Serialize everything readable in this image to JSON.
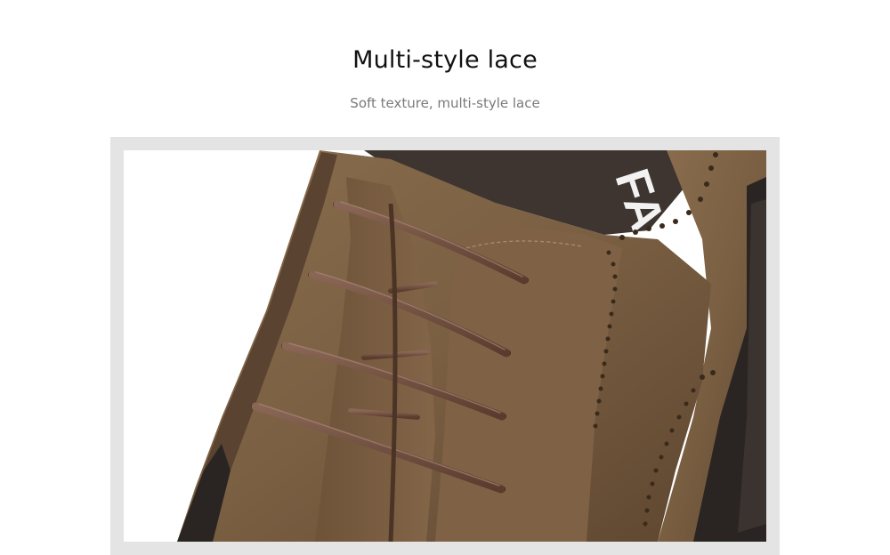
{
  "heading": {
    "title": "Multi-style lace",
    "subtitle": "Soft texture, multi-style lace"
  },
  "image": {
    "subject": "brown-leather-brogue-shoe-laces",
    "colors": {
      "frame": "#e4e4e4",
      "leather": "#7a5f42",
      "leather_dark": "#4f3a27",
      "lace": "#6b4a3a",
      "sole": "#2a2522",
      "insole": "#3e3530"
    }
  }
}
